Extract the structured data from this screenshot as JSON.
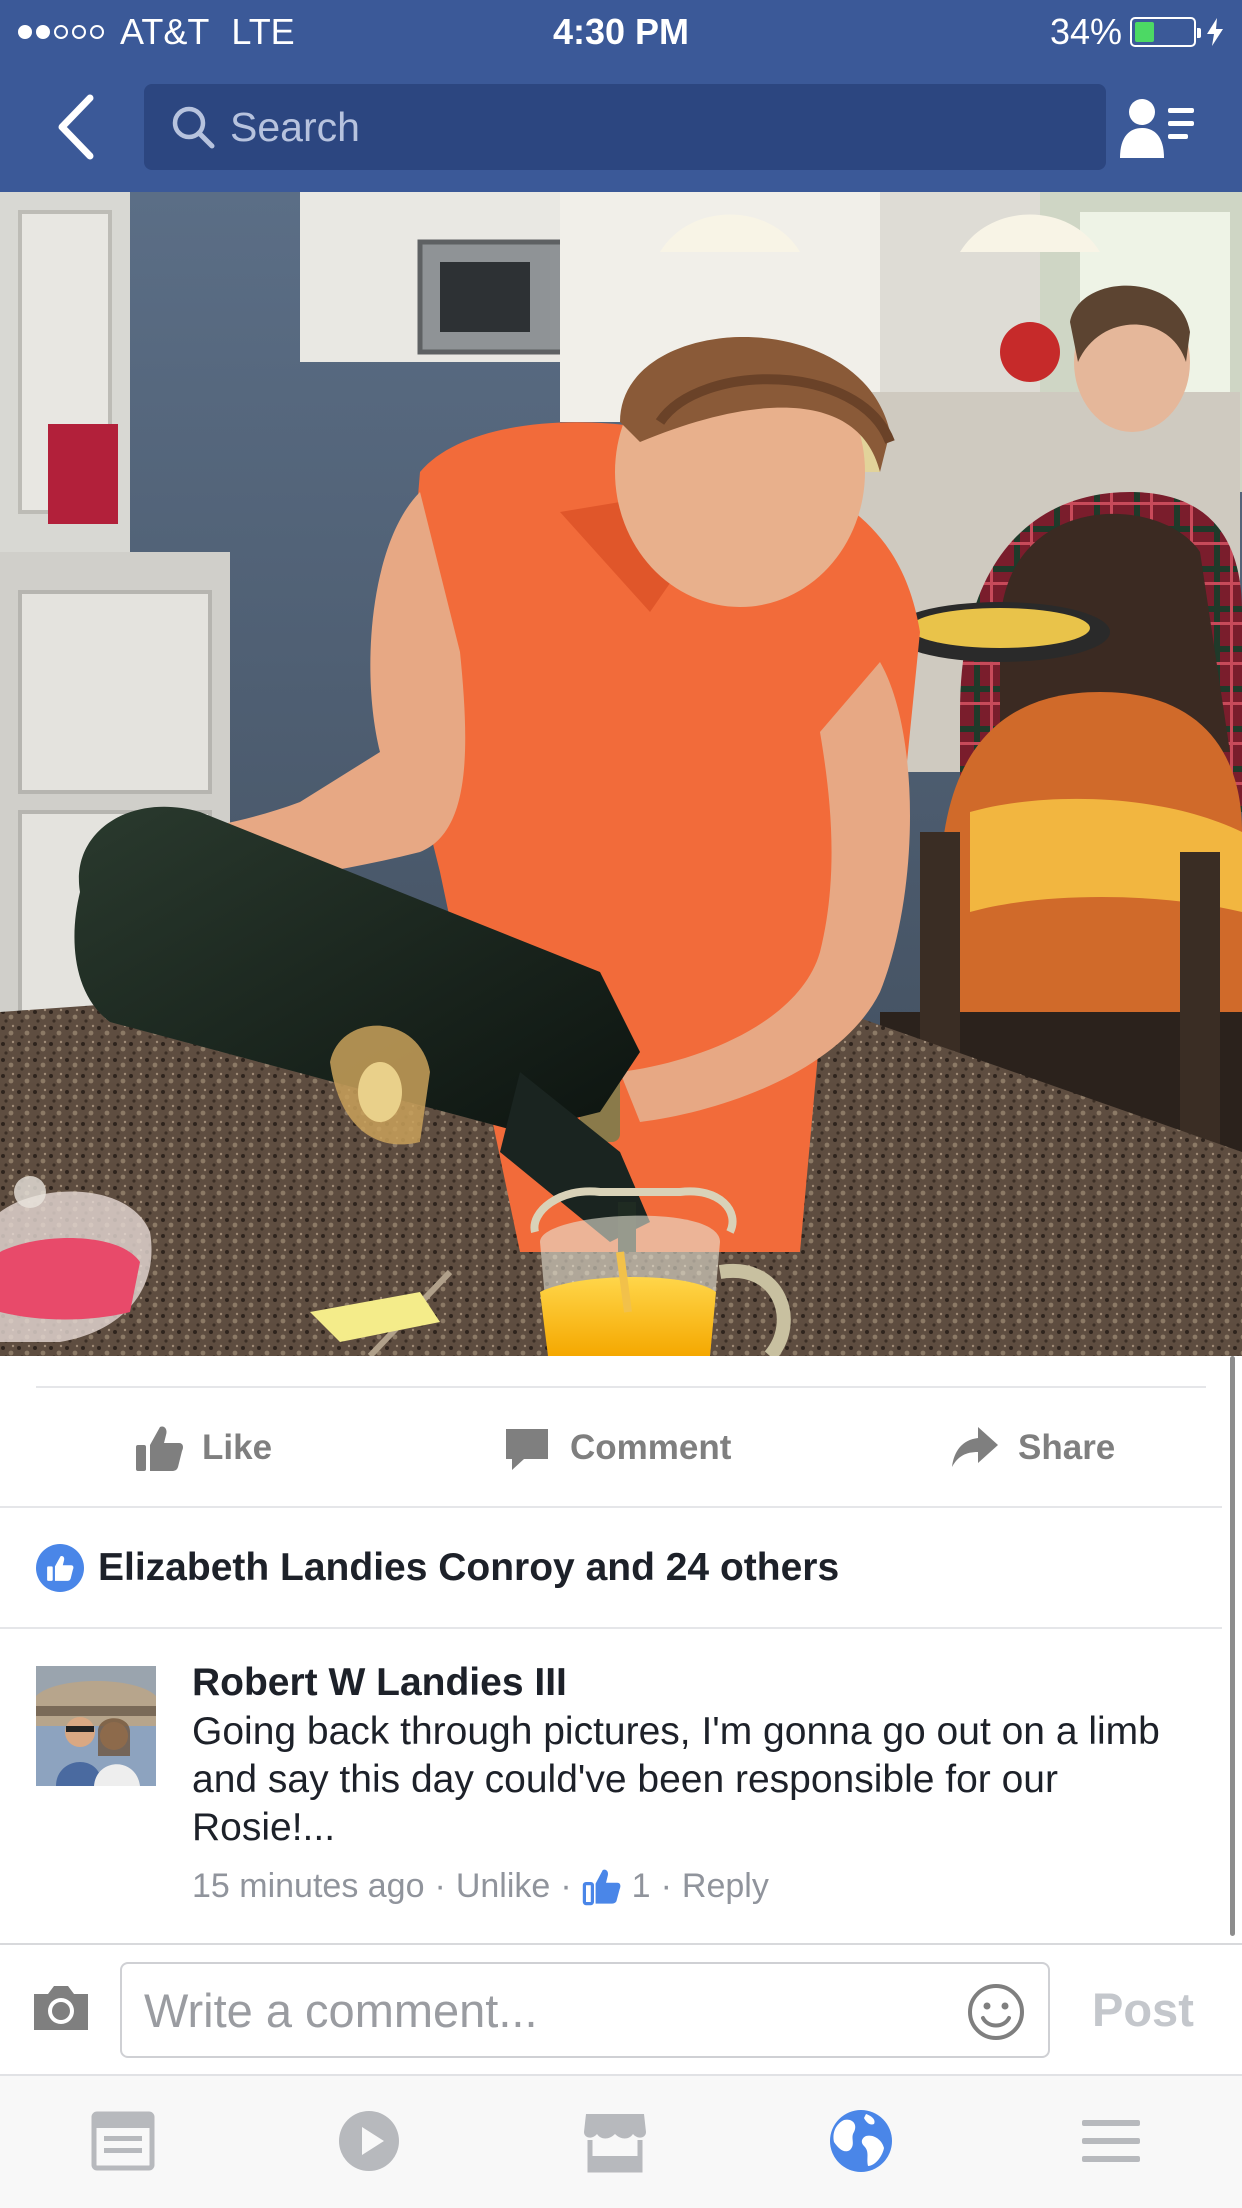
{
  "status_bar": {
    "carrier": "AT&T",
    "network": "LTE",
    "time": "4:30 PM",
    "battery_percent": "34%",
    "battery_level": 0.34,
    "signal_bars_filled": 2,
    "signal_bars_total": 5
  },
  "nav": {
    "search_placeholder": "Search"
  },
  "actions": {
    "like": "Like",
    "comment": "Comment",
    "share": "Share"
  },
  "likes": {
    "summary": "Elizabeth Landies Conroy and 24 others"
  },
  "comment": {
    "author": "Robert W Landies III",
    "text": "Going back through pictures, I'm gonna go out on a limb and say this day could've been responsible for our Rosie!...",
    "time": "15 minutes ago",
    "unlike": "Unlike",
    "like_count": "1",
    "reply": "Reply"
  },
  "composer": {
    "placeholder": "Write a comment...",
    "post": "Post"
  },
  "colors": {
    "brand": "#3b5998",
    "like_blue": "#4a86e8",
    "muted": "#90949c",
    "active_tab": "#4a86e8",
    "inactive_tab": "#b7b9bd"
  }
}
